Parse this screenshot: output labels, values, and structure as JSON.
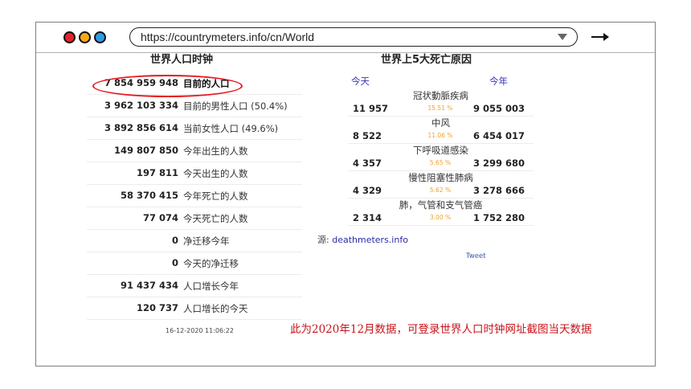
{
  "browser": {
    "url": "https://countrymeters.info/cn/World",
    "dots": [
      "#e8222a",
      "#f5a81c",
      "#2e9be3"
    ]
  },
  "clock": {
    "title": "世界人口时钟",
    "rows": [
      {
        "value": "7 854 959 948",
        "label": "目前的人口"
      },
      {
        "value": "3 962 103 334",
        "label": "目前的男性人口 (50.4%)"
      },
      {
        "value": "3 892 856 614",
        "label": "当前女性人口 (49.6%)"
      },
      {
        "value": "149 807 850",
        "label": "今年出生的人数"
      },
      {
        "value": "197 811",
        "label": "今天出生的人数"
      },
      {
        "value": "58 370 415",
        "label": "今年死亡的人数"
      },
      {
        "value": "77 074",
        "label": "今天死亡的人数"
      },
      {
        "value": "0",
        "label": "净迁移今年"
      },
      {
        "value": "0",
        "label": "今天的净迁移"
      },
      {
        "value": "91 437 434",
        "label": "人口增长今年"
      },
      {
        "value": "120 737",
        "label": "人口增长的今天"
      }
    ],
    "timestamp": "16-12-2020 11:06:22"
  },
  "deaths": {
    "title": "世界上5大死亡原因",
    "header_today": "今天",
    "header_year": "今年",
    "rows": [
      {
        "cause": "冠状動脈疾病",
        "today": "11 957",
        "percent": "15.51 %",
        "year": "9 055 003"
      },
      {
        "cause": "中风",
        "today": "8 522",
        "percent": "11.06 %",
        "year": "6 454 017"
      },
      {
        "cause": "下呼吸道感染",
        "today": "4 357",
        "percent": "5.65 %",
        "year": "3 299 680"
      },
      {
        "cause": "慢性阻塞性肺病",
        "today": "4 329",
        "percent": "5.62 %",
        "year": "3 278 666"
      },
      {
        "cause": "肺，气管和支气管癌",
        "today": "2 314",
        "percent": "3.00 %",
        "year": "1 752 280"
      }
    ],
    "source_prefix": "源:",
    "source_link": "deathmeters.info",
    "tweet": "Tweet"
  },
  "annotation": {
    "note": "此为2020年12月数据，可登录世界人口时钟网址截图当天数据",
    "color": "#c8151b"
  }
}
